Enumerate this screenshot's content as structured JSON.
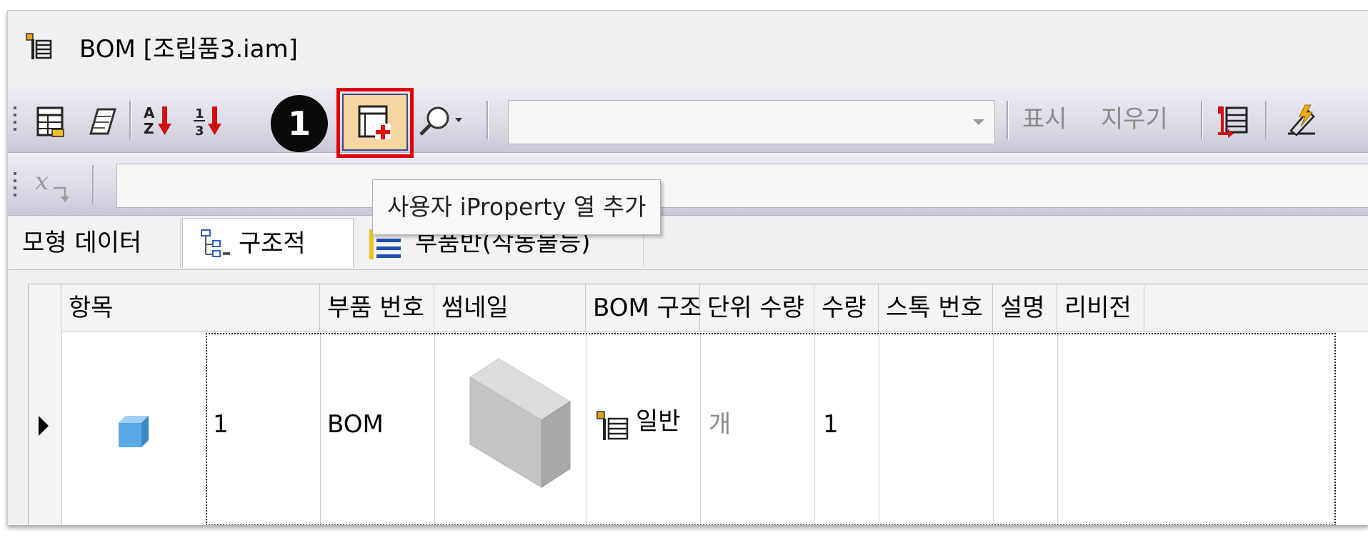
{
  "window": {
    "title": "BOM [조립품3.iam]"
  },
  "toolbar": {
    "icons": [
      "bom-view-icon",
      "edit-icon",
      "sort-alpha-icon",
      "sort-numeric-icon",
      "add-user-iproperty-column-icon",
      "search-icon"
    ],
    "combo_value": "",
    "show_label": "표시",
    "clear_label": "지우기"
  },
  "callout": {
    "number": "1"
  },
  "tooltip": {
    "text": "사용자 iProperty 열 추가"
  },
  "tabs": [
    {
      "label": "모형 데이터",
      "active": false
    },
    {
      "label": "구조적",
      "active": true
    },
    {
      "label": "부품반(작동불능)",
      "active": false
    }
  ],
  "grid": {
    "columns": [
      "항목",
      "부품 번호",
      "썸네일",
      "BOM 구조",
      "단위 수량",
      "수량",
      "스톡 번호",
      "설명",
      "리비전"
    ],
    "rows": [
      {
        "item": "1",
        "part_number": "BOM",
        "bom_structure": "일반",
        "unit_qty": "개",
        "qty": "1",
        "stock_number": "",
        "description": "",
        "revision": ""
      }
    ]
  },
  "colors": {
    "highlight": "#e00000",
    "accent_red": "#d01010",
    "part_blue": "#5aa8e6"
  }
}
